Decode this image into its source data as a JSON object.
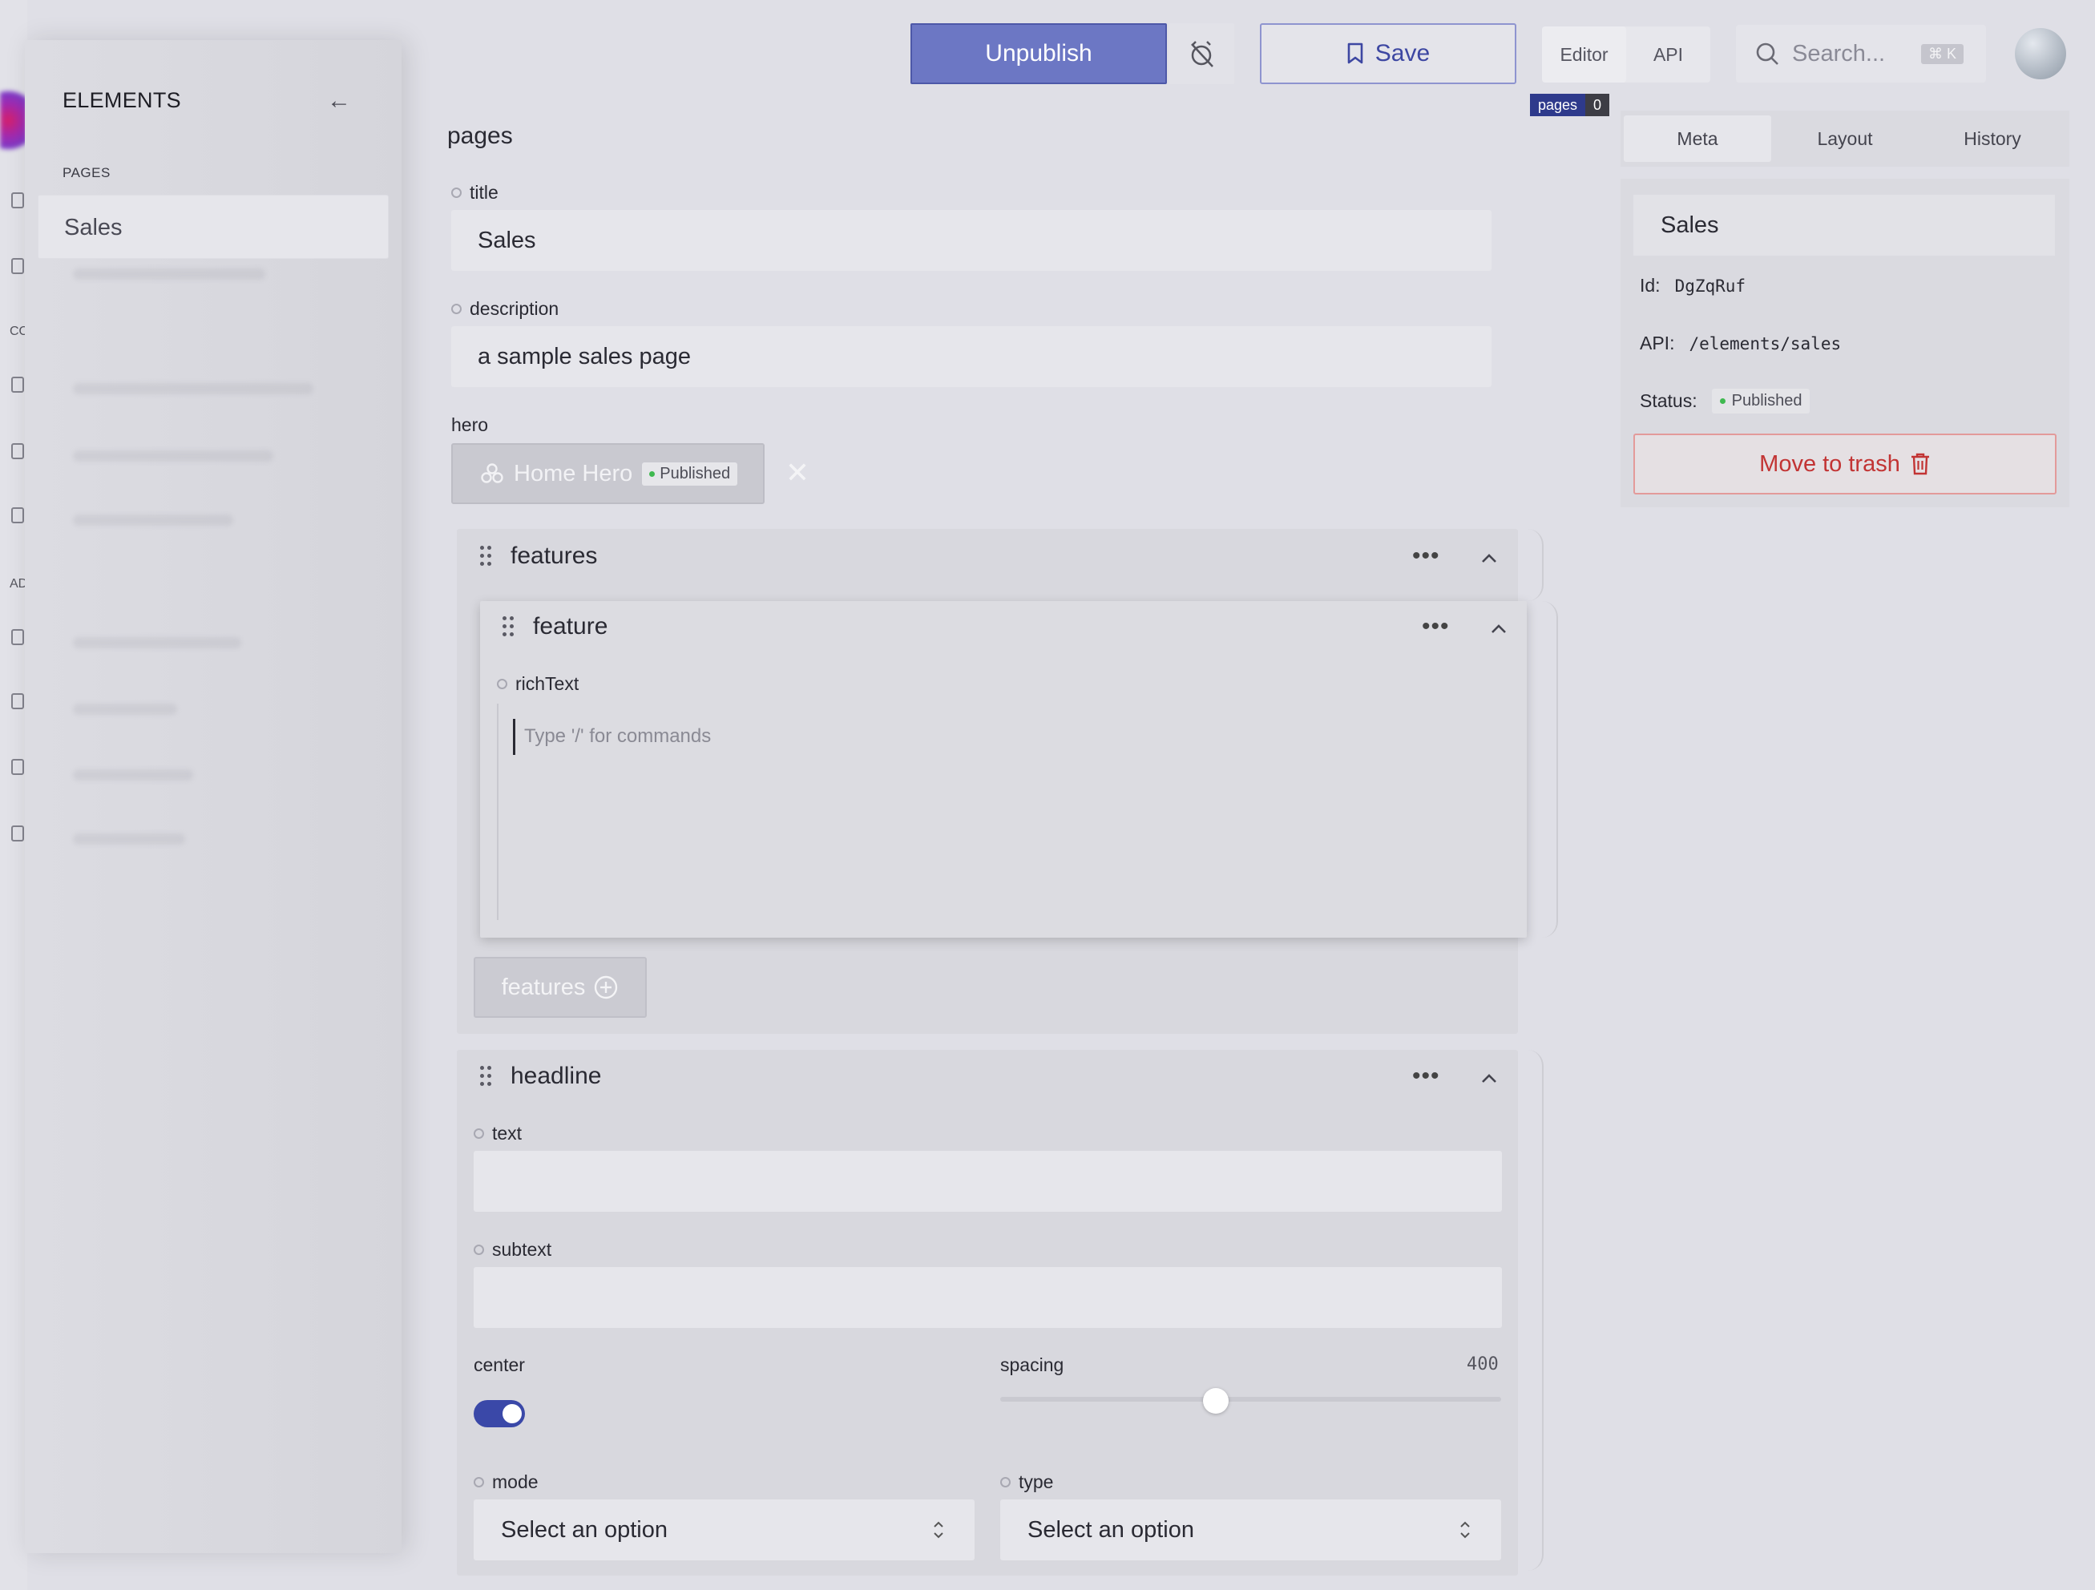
{
  "topbar": {
    "unpublish_label": "Unpublish",
    "save_label": "Save",
    "mode_tabs": [
      "Editor",
      "API"
    ],
    "search_placeholder": "Search...",
    "search_shortcut": "⌘ K",
    "pages_badge_label": "pages",
    "pages_badge_count": "0"
  },
  "drawer": {
    "title": "ELEMENTS",
    "section_label": "PAGES",
    "items": [
      {
        "label": "Sales"
      }
    ]
  },
  "rail": {
    "letters": [
      "CO",
      "AD"
    ]
  },
  "editor": {
    "title": "pages",
    "fields": {
      "title": {
        "label": "title",
        "value": "Sales"
      },
      "description": {
        "label": "description",
        "value": "a sample sales page"
      },
      "hero": {
        "label": "hero",
        "chip_label": "Home Hero",
        "chip_status": "Published"
      }
    },
    "features": {
      "label": "features",
      "feature": {
        "label": "feature",
        "rich_text_label": "richText",
        "rich_text_placeholder": "Type '/' for commands"
      },
      "add_label": "features"
    },
    "headline": {
      "label": "headline",
      "text_label": "text",
      "text_value": "",
      "subtext_label": "subtext",
      "subtext_value": "",
      "center_label": "center",
      "center_on": true,
      "spacing_label": "spacing",
      "spacing_value": "400",
      "spacing_fraction": 0.43,
      "mode_label": "mode",
      "mode_value": "Select an option",
      "type_label": "type",
      "type_value": "Select an option"
    }
  },
  "meta": {
    "tabs": [
      "Meta",
      "Layout",
      "History"
    ],
    "active_tab": "Meta",
    "title": "Sales",
    "id_label": "Id:",
    "id_value": "DgZqRuf",
    "api_label": "API:",
    "api_value": "/elements/sales",
    "status_label": "Status:",
    "status_value": "Published",
    "trash_label": "Move to trash"
  },
  "colors": {
    "accent": "#3a48a8",
    "danger": "#c23434",
    "published": "#3fb950"
  }
}
